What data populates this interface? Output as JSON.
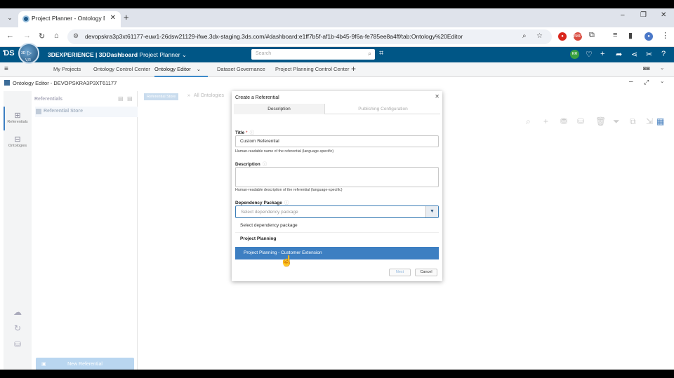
{
  "browser": {
    "tab_title": "Project Planner - Ontology Edi",
    "tab_close": "✕",
    "new_tab": "+",
    "window_controls": [
      "–",
      "❐",
      "✕"
    ],
    "url": "devopskra3p3xt61177-euw1-26dsw21129-ifwe.3dx-staging.3ds.com/#dashboard:e1ff7b5f-af1b-4b45-9f6a-fe785ee8a4ff/tab:Ontology%20Editor",
    "extensions": [
      "ABP"
    ]
  },
  "app_header": {
    "brand_prefix": "3DEXPERIENCE | 3DDashboard",
    "brand_app": "Project Planner",
    "search_placeholder": "Search",
    "avatar_initials": "KR",
    "compass_label": "V,R",
    "compass_3d": "3D"
  },
  "dashboard_tabs": [
    "My Projects",
    "Ontology Control Center",
    "Ontology Editor",
    "Dataset Governance",
    "Project Planning Control Center"
  ],
  "widget_title": "Ontology Editor - DEVOPSKRA3P3XT61177",
  "left_nav": [
    {
      "label": "Referentials"
    },
    {
      "label": "Ontologies"
    }
  ],
  "panel": {
    "header": "Referentials",
    "item": "Referential Store",
    "new_button": "New Referential"
  },
  "breadcrumb": {
    "store": "Referential Store",
    "sep": "»",
    "current": "All Ontologies"
  },
  "dialog": {
    "title": "Create a Referential",
    "tabs": [
      "Description",
      "Publishing Configuration"
    ],
    "title_label": "Title",
    "title_value": "Custom Referential",
    "title_help": "Human-readable name of the referential (language-specific)",
    "description_label": "Description",
    "description_help": "Human-readable description of the referential (language-specific)",
    "dependency_label": "Dependency Package",
    "dependency_placeholder": "Select dependency package",
    "options": [
      {
        "label": "Select dependency package",
        "kind": "placeholder"
      },
      {
        "label": "Project Planning",
        "kind": "group"
      },
      {
        "label": "Project Planning - Customer Extension",
        "kind": "selected"
      }
    ],
    "next_button": "Next",
    "cancel_button": "Cancel"
  },
  "colors": {
    "header": "#005686",
    "accent": "#3d7fc2"
  }
}
